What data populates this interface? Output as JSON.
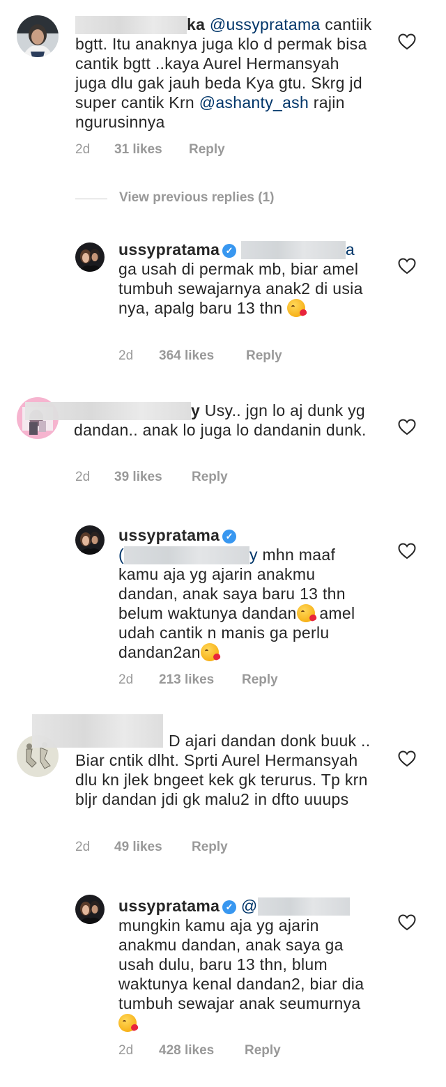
{
  "comments": [
    {
      "username_visible_suffix": "ka",
      "mention": "@ussypratama",
      "text_line1_rest": " cantiik",
      "text_rest": "bgtt. Itu anaknya juga klo d permak bisa cantik bgtt ..kaya Aurel Hermansyah juga dlu gak jauh beda Kya gtu. Skrg jd super cantik Krn ",
      "mention2": "@ashanty_ash",
      "text_end": " rajin ngurusinnya",
      "time": "2d",
      "likes": "31 likes",
      "reply": "Reply"
    },
    {
      "view_previous": "View previous replies (1)"
    },
    {
      "username": "ussypratama",
      "mention_suffix": "a",
      "text": "ga usah di permak mb, biar amel tumbuh sewajarnya anak2 di usia nya, apalg baru 13 thn",
      "time": "2d",
      "likes": "364 likes",
      "reply": "Reply"
    },
    {
      "username_visible_suffix": "y",
      "text_line1": " Usy.. jgn lo aj dunk",
      "text": "yg dandan.. anak lo juga lo dandanin dunk.",
      "time": "2d",
      "likes": "39 likes",
      "reply": "Reply"
    },
    {
      "username": "ussypratama",
      "mention_prefix": "(",
      "mention_suffix": "y",
      "text_line1": " mhn maaf",
      "text_a": "kamu aja yg ajarin anakmu dandan, anak saya baru 13 thn belum waktunya dandan",
      "text_b": "amel udah cantik n manis ga perlu dandan2an",
      "time": "2d",
      "likes": "213 likes",
      "reply": "Reply"
    },
    {
      "text_line1": "D ajari dandan donk",
      "text": "buuk .. Biar cntik dlht. Sprti Aurel Hermansyah dlu kn jlek bngeet kek gk terurus. Tp krn bljr dandan jdi gk malu2 in dfto uuups",
      "time": "2d",
      "likes": "49 likes",
      "reply": "Reply"
    },
    {
      "username": "ussypratama",
      "mention_prefix": "@",
      "text": "mungkin kamu aja yg ajarin anakmu dandan, anak saya ga usah dulu, baru 13 thn, blum waktunya kenal dandan2, biar dia tumbuh sewajar anak seumurnya",
      "time": "2d",
      "likes": "428 likes",
      "reply": "Reply"
    }
  ],
  "icons": {
    "heart": "heart-outline-icon",
    "verified": "verified-badge-icon",
    "emoji": "face-blowing-kiss-emoji"
  },
  "colors": {
    "text": "#262626",
    "mention": "#003569",
    "meta": "#999999",
    "verified": "#3897f0",
    "heart_stroke": "#262626"
  }
}
